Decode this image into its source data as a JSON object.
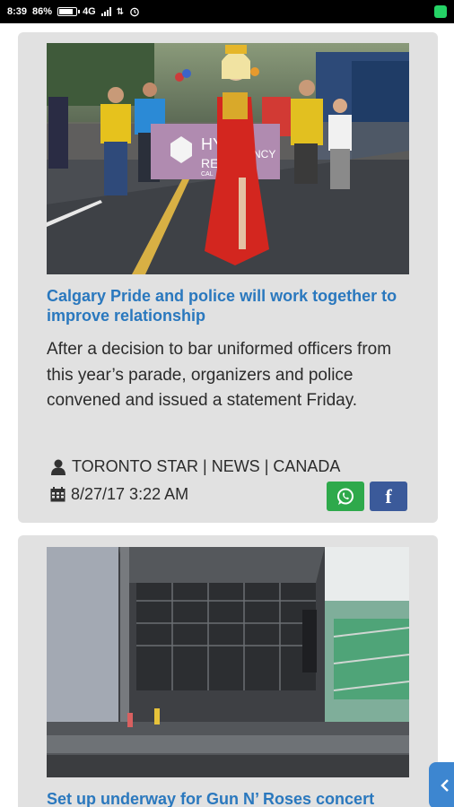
{
  "status_bar": {
    "time": "8:39",
    "battery_percent": "86%",
    "battery_level": 0.86,
    "network": "4G",
    "icons": [
      "battery-icon",
      "signal-icon",
      "data-arrows-icon",
      "alarm-icon",
      "whatsapp-notification-icon"
    ]
  },
  "articles": [
    {
      "headline": "Calgary Pride and police will work together to improve relationship",
      "summary": "After a decision to bar uniformed officers from this year’s parade, organizers and police convened and issued a statement Friday.",
      "source": "TORONTO STAR | NEWS | CANADA",
      "date": "8/27/17 3:22 AM",
      "photo_icon": "pride-parade-photo",
      "banner_text_1": "HY",
      "banner_text_2": "RE",
      "banner_text_3": "NCY",
      "banner_text_4": "CAL"
    },
    {
      "headline": "Set up underway for Gun N’ Roses concert",
      "photo_icon": "stadium-stage-photo"
    }
  ],
  "share": {
    "whatsapp_icon": "whatsapp-icon",
    "facebook_label": "f"
  },
  "colors": {
    "headline": "#2a78be",
    "card_bg": "#e1e1e1",
    "whatsapp": "#2ea94b",
    "facebook": "#3b5a9a",
    "floating_tab": "#3d86d0"
  }
}
